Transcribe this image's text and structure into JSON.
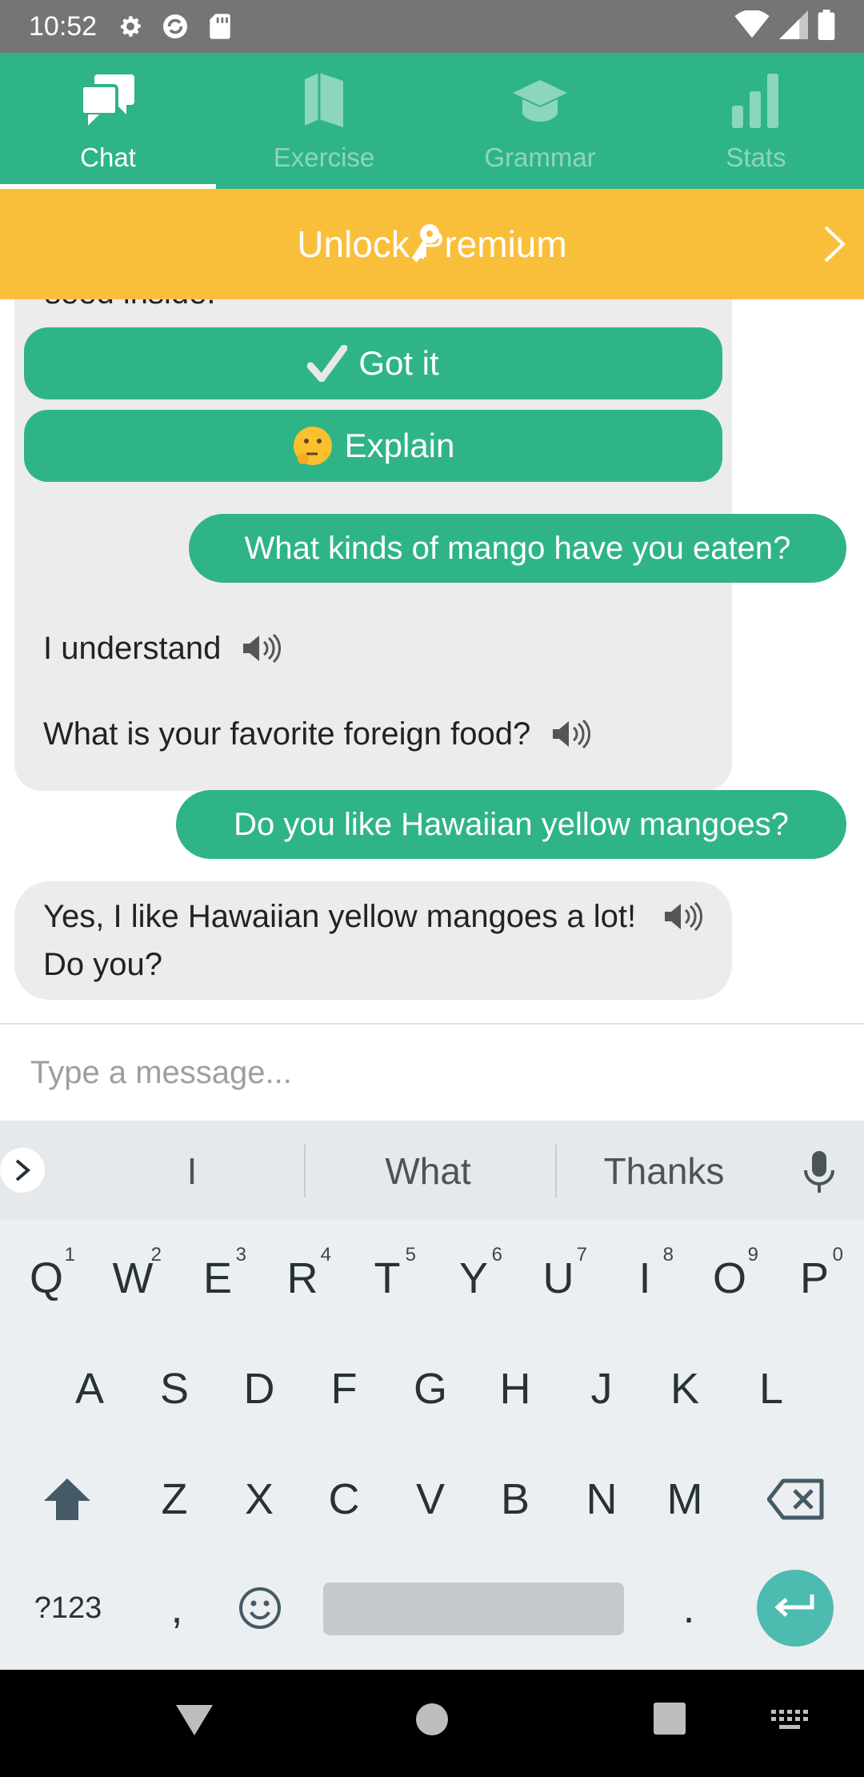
{
  "status_bar": {
    "time": "10:52"
  },
  "tabs": [
    {
      "label": "Chat",
      "icon": "chat-icon",
      "active": true
    },
    {
      "label": "Exercise",
      "icon": "book-icon",
      "active": false
    },
    {
      "label": "Grammar",
      "icon": "graduation-cap-icon",
      "active": false
    },
    {
      "label": "Stats",
      "icon": "bar-chart-icon",
      "active": false
    }
  ],
  "premium": {
    "label": "Unlock Premium"
  },
  "chat": {
    "card_cut_text": "seed inside.",
    "got_it_label": "Got it",
    "explain_label": "Explain",
    "messages": [
      {
        "from": "user",
        "text": "What kinds of mango have you eaten?"
      },
      {
        "from": "bot",
        "text": "I understand"
      },
      {
        "from": "bot",
        "text": "What is your favorite foreign food?"
      },
      {
        "from": "user",
        "text": "Do you like Hawaiian yellow mangoes?"
      },
      {
        "from": "bot",
        "text": "Yes, I like Hawaiian yellow mangoes a lot! Do you?"
      }
    ]
  },
  "input": {
    "placeholder": "Type a message..."
  },
  "keyboard": {
    "suggestions": [
      "I",
      "What",
      "Thanks"
    ],
    "row1": [
      "Q",
      "W",
      "E",
      "R",
      "T",
      "Y",
      "U",
      "I",
      "O",
      "P"
    ],
    "row1_hints": [
      "1",
      "2",
      "3",
      "4",
      "5",
      "6",
      "7",
      "8",
      "9",
      "0"
    ],
    "row2": [
      "A",
      "S",
      "D",
      "F",
      "G",
      "H",
      "J",
      "K",
      "L"
    ],
    "row3": [
      "Z",
      "X",
      "C",
      "V",
      "B",
      "N",
      "M"
    ],
    "symbols_label": "?123",
    "comma": ",",
    "period": "."
  },
  "colors": {
    "brand": "#2fb488",
    "premium": "#f9bf3b",
    "bubble_bot": "#ececec"
  }
}
